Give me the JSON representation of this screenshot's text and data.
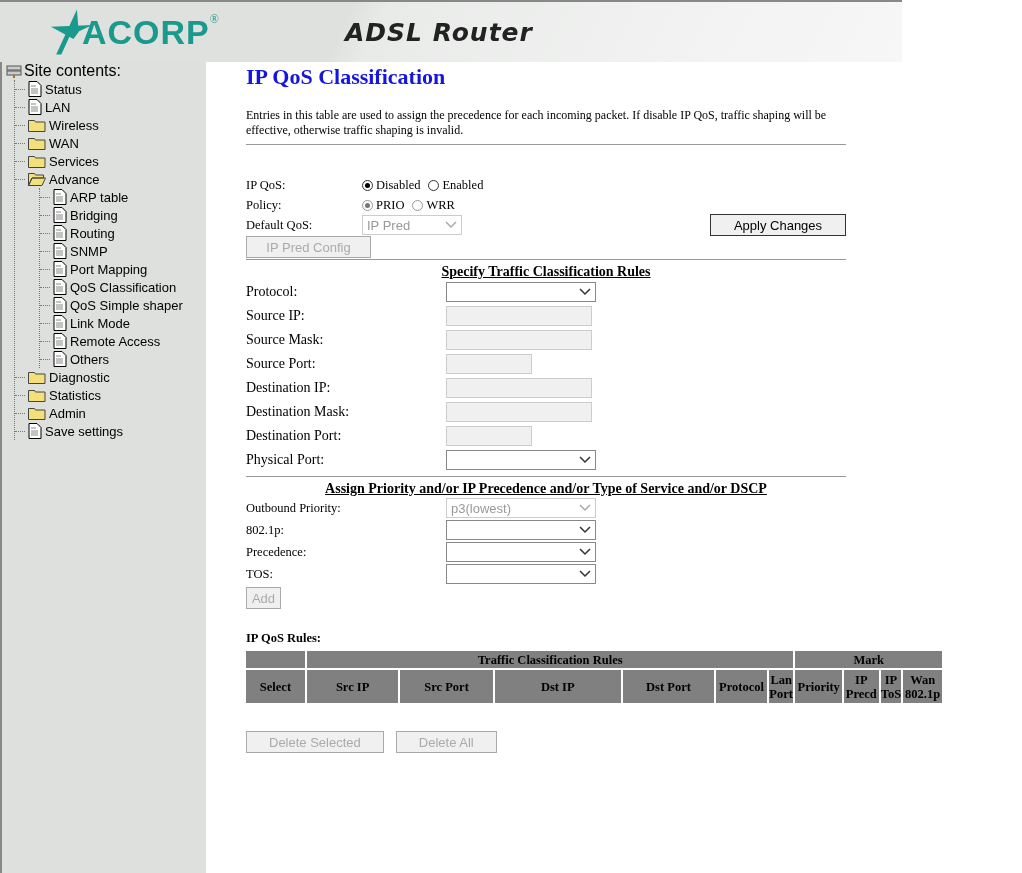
{
  "header": {
    "logo": "ACORP",
    "registered": "®",
    "title": "ADSL Router"
  },
  "sidebar": {
    "title": "Site contents:",
    "items": [
      {
        "label": "Status",
        "kind": "page"
      },
      {
        "label": "LAN",
        "kind": "page"
      },
      {
        "label": "Wireless",
        "kind": "folder",
        "expanded": false
      },
      {
        "label": "WAN",
        "kind": "folder",
        "expanded": false
      },
      {
        "label": "Services",
        "kind": "folder",
        "expanded": false
      },
      {
        "label": "Advance",
        "kind": "folder",
        "expanded": true,
        "children": [
          {
            "label": "ARP table",
            "kind": "page"
          },
          {
            "label": "Bridging",
            "kind": "page"
          },
          {
            "label": "Routing",
            "kind": "page"
          },
          {
            "label": "SNMP",
            "kind": "page"
          },
          {
            "label": "Port Mapping",
            "kind": "page"
          },
          {
            "label": "QoS Classification",
            "kind": "page"
          },
          {
            "label": "QoS Simple shaper",
            "kind": "page"
          },
          {
            "label": "Link Mode",
            "kind": "page"
          },
          {
            "label": "Remote Access",
            "kind": "page"
          },
          {
            "label": "Others",
            "kind": "page"
          }
        ]
      },
      {
        "label": "Diagnostic",
        "kind": "folder",
        "expanded": false
      },
      {
        "label": "Statistics",
        "kind": "folder",
        "expanded": false
      },
      {
        "label": "Admin",
        "kind": "folder",
        "expanded": false
      },
      {
        "label": "Save settings",
        "kind": "page"
      }
    ]
  },
  "page": {
    "title": "IP QoS Classification",
    "description": "Entries in this table are used to assign the precedence for each incoming packet. If disable IP QoS, traffic shaping will be effective, otherwise traffic shaping is invalid."
  },
  "settings": {
    "ip_qos": {
      "label": "IP QoS:",
      "disabled": false,
      "options": [
        {
          "label": "Disabled",
          "selected": true
        },
        {
          "label": "Enabled",
          "selected": false
        }
      ]
    },
    "policy": {
      "label": "Policy:",
      "disabled": true,
      "options": [
        {
          "label": "PRIO",
          "selected": true
        },
        {
          "label": "WRR",
          "selected": false
        }
      ]
    },
    "default_qos": {
      "label": "Default QoS:",
      "value": "IP Pred",
      "disabled": true
    },
    "apply_button": {
      "label": "Apply Changes",
      "disabled": false
    },
    "ip_pred_button": {
      "label": "IP Pred Config",
      "disabled": true
    }
  },
  "rules_form": {
    "title": "Specify Traffic Classification Rules",
    "fields": [
      {
        "label": "Protocol:",
        "kind": "select",
        "disabled": false
      },
      {
        "label": "Source IP:",
        "kind": "text",
        "disabled": true
      },
      {
        "label": "Source Mask:",
        "kind": "text",
        "disabled": true
      },
      {
        "label": "Source Port:",
        "kind": "port",
        "disabled": true
      },
      {
        "label": "Destination IP:",
        "kind": "text",
        "disabled": true
      },
      {
        "label": "Destination Mask:",
        "kind": "text",
        "disabled": true
      },
      {
        "label": "Destination Port:",
        "kind": "port",
        "disabled": true
      },
      {
        "label": "Physical Port:",
        "kind": "select",
        "disabled": false
      }
    ]
  },
  "priority_form": {
    "title": "Assign Priority and/or IP Precedence and/or Type of Service and/or DSCP",
    "fields": [
      {
        "label": "Outbound Priority:",
        "value": "p3(lowest)",
        "disabled": true
      },
      {
        "label": "802.1p:",
        "disabled": false
      },
      {
        "label": "Precedence:",
        "disabled": false
      },
      {
        "label": "TOS:",
        "disabled": false
      }
    ],
    "add_button": {
      "label": "Add",
      "disabled": true
    }
  },
  "rules_table": {
    "title": "IP QoS Rules:",
    "groups": [
      {
        "columns": [
          "Select"
        ]
      },
      {
        "label": "Traffic Classification Rules",
        "columns": [
          "Src IP",
          "Src Port",
          "Dst IP",
          "Dst Port",
          "Protocol",
          "Lan Port"
        ]
      },
      {
        "label": "Mark",
        "columns": [
          "Priority",
          "IP Precd",
          "IP ToS",
          "Wan 802.1p"
        ]
      }
    ]
  },
  "buttons": [
    {
      "label": "Delete Selected",
      "disabled": true
    },
    {
      "label": "Delete All",
      "disabled": true
    }
  ]
}
